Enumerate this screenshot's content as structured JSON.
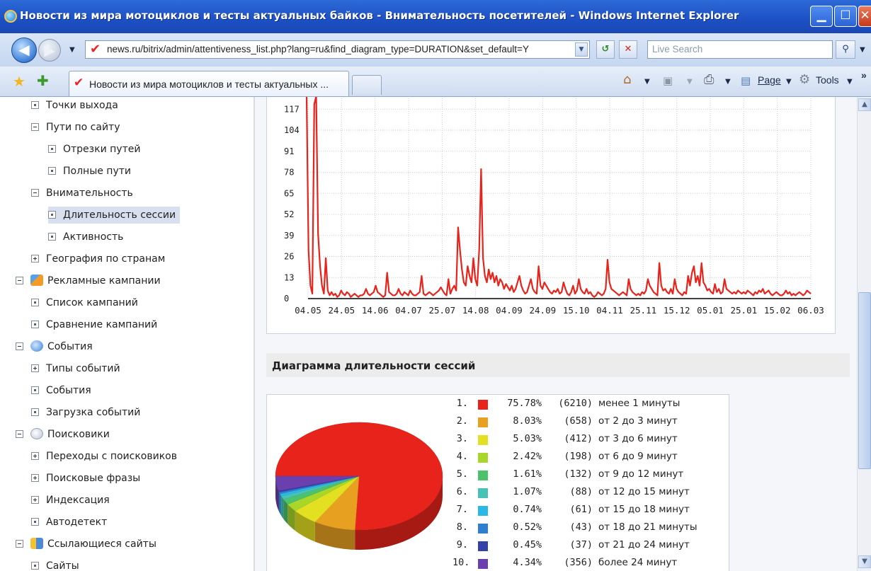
{
  "window": {
    "title": "Новости из мира мотоциклов и тесты актуальных байков - Внимательность посетителей - Windows Internet Explorer"
  },
  "browser": {
    "url": "news.ru/bitrix/admin/attentiveness_list.php?lang=ru&find_diagram_type=DURATION&set_default=Y",
    "search_placeholder": "Live Search",
    "tab_title": "Новости из мира мотоциклов и тесты актуальных ...",
    "page_label": "Page",
    "tools_label": "Tools",
    "more_label": "»"
  },
  "sidebar": {
    "items": [
      {
        "label": "Точки выхода"
      },
      {
        "label": "Пути по сайту"
      },
      {
        "label": "Отрезки путей"
      },
      {
        "label": "Полные пути"
      },
      {
        "label": "Внимательность"
      },
      {
        "label": "Длительность сессии"
      },
      {
        "label": "Активность"
      },
      {
        "label": "География по странам"
      },
      {
        "label": "Рекламные кампании"
      },
      {
        "label": "Список кампаний"
      },
      {
        "label": "Сравнение кампаний"
      },
      {
        "label": "События"
      },
      {
        "label": "Типы событий"
      },
      {
        "label": "События"
      },
      {
        "label": "Загрузка событий"
      },
      {
        "label": "Поисковики"
      },
      {
        "label": "Переходы с поисковиков"
      },
      {
        "label": "Поисковые фразы"
      },
      {
        "label": "Индексация"
      },
      {
        "label": "Автодетект"
      },
      {
        "label": "Ссылающиеся сайты"
      },
      {
        "label": "Сайты"
      }
    ]
  },
  "content": {
    "section_title": "Диаграмма длительности сессий"
  },
  "chart_data": [
    {
      "type": "line",
      "color": "#e8231b",
      "y_ticks": [
        "0",
        "13",
        "26",
        "39",
        "52",
        "65",
        "78",
        "91",
        "104",
        "117"
      ],
      "ylim": [
        0,
        125
      ],
      "x_ticks": [
        "04.05",
        "24.05",
        "14.06",
        "04.07",
        "25.07",
        "14.08",
        "04.09",
        "24.09",
        "15.10",
        "04.11",
        "25.11",
        "15.12",
        "05.01",
        "25.01",
        "15.02",
        "06.03"
      ],
      "grid": true,
      "values": [
        125,
        30,
        8,
        3,
        120,
        125,
        40,
        20,
        8,
        3,
        25,
        5,
        2,
        4,
        2,
        3,
        1,
        2,
        5,
        3,
        2,
        4,
        3,
        1,
        2,
        3,
        2,
        1,
        2,
        2,
        3,
        6,
        3,
        2,
        3,
        4,
        8,
        4,
        3,
        2,
        1,
        2,
        16,
        4,
        3,
        2,
        2,
        3,
        6,
        3,
        2,
        4,
        3,
        2,
        5,
        3,
        2,
        2,
        3,
        4,
        14,
        3,
        2,
        3,
        4,
        3,
        2,
        3,
        4,
        5,
        7,
        5,
        3,
        2,
        12,
        3,
        6,
        8,
        5,
        44,
        30,
        18,
        10,
        8,
        20,
        14,
        10,
        25,
        12,
        8,
        30,
        80,
        25,
        14,
        10,
        18,
        12,
        16,
        10,
        14,
        8,
        12,
        10,
        6,
        9,
        7,
        5,
        8,
        4,
        6,
        10,
        14,
        8,
        5,
        3,
        4,
        8,
        12,
        6,
        4,
        3,
        20,
        8,
        6,
        10,
        8,
        6,
        4,
        3,
        5,
        4,
        6,
        3,
        4,
        10,
        6,
        3,
        2,
        4,
        8,
        3,
        5,
        12,
        6,
        4,
        3,
        6,
        3,
        4,
        2,
        1,
        2,
        4,
        3,
        2,
        3,
        6,
        24,
        10,
        6,
        5,
        4,
        3,
        2,
        3,
        4,
        3,
        2,
        12,
        6,
        4,
        3,
        2,
        3,
        2,
        4,
        3,
        5,
        12,
        8,
        6,
        4,
        3,
        2,
        22,
        8,
        5,
        6,
        4,
        3,
        6,
        3,
        12,
        6,
        4,
        3,
        2,
        4,
        3,
        14,
        8,
        16,
        20,
        10,
        14,
        8,
        22,
        10,
        8,
        5,
        6,
        4,
        3,
        9,
        4,
        6,
        3,
        4,
        12,
        6,
        5,
        4,
        3,
        4,
        3,
        5,
        4,
        3,
        4,
        3,
        5,
        4,
        3,
        2,
        4,
        3,
        5,
        4,
        6,
        3,
        4,
        5,
        3,
        2,
        3,
        4,
        3,
        2,
        2,
        3,
        5,
        3,
        4,
        2,
        3,
        2,
        3,
        4,
        3,
        2,
        3,
        5,
        4,
        3
      ]
    },
    {
      "type": "pie",
      "slices": [
        {
          "rank": "1.",
          "percent": "75.78%",
          "count": "(6210)",
          "label": "менее 1 минуты",
          "value": 75.78,
          "color": "#e8231b"
        },
        {
          "rank": "2.",
          "percent": "8.03%",
          "count": "(658)",
          "label": "от 2 до 3 минут",
          "value": 8.03,
          "color": "#e8a021"
        },
        {
          "rank": "3.",
          "percent": "5.03%",
          "count": "(412)",
          "label": "от 3 до 6 минут",
          "value": 5.03,
          "color": "#e3e021"
        },
        {
          "rank": "4.",
          "percent": "2.42%",
          "count": "(198)",
          "label": "от 6 до 9 минут",
          "value": 2.42,
          "color": "#a8d62a"
        },
        {
          "rank": "5.",
          "percent": "1.61%",
          "count": "(132)",
          "label": "от 9 до 12 минут",
          "value": 1.61,
          "color": "#4cc26b"
        },
        {
          "rank": "6.",
          "percent": "1.07%",
          "count": "(88)",
          "label": "от 12 до 15 минут",
          "value": 1.07,
          "color": "#48c2b6"
        },
        {
          "rank": "7.",
          "percent": "0.74%",
          "count": "(61)",
          "label": "от 15 до 18 минут",
          "value": 0.74,
          "color": "#2ab8e6"
        },
        {
          "rank": "8.",
          "percent": "0.52%",
          "count": "(43)",
          "label": "от 18 до 21 минуты",
          "value": 0.52,
          "color": "#2f7fd0"
        },
        {
          "rank": "9.",
          "percent": "0.45%",
          "count": "(37)",
          "label": "от 21 до 24 минут",
          "value": 0.45,
          "color": "#3341a8"
        },
        {
          "rank": "10.",
          "percent": "4.34%",
          "count": "(356)",
          "label": "более 24 минут",
          "value": 4.34,
          "color": "#6b3fae"
        }
      ]
    }
  ]
}
